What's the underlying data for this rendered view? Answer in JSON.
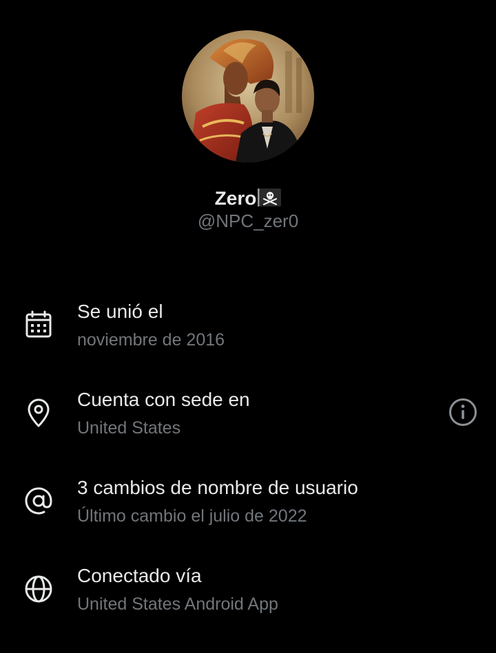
{
  "profile": {
    "display_name": "Zero",
    "name_emoji": "pirate-flag-emoji",
    "handle": "@NPC_zer0",
    "avatar": "profile-photo"
  },
  "info": [
    {
      "icon": "calendar-icon",
      "title": "Se unió el",
      "subtitle": "noviembre de 2016"
    },
    {
      "icon": "location-pin-icon",
      "title": "Cuenta con sede en",
      "subtitle": "United States",
      "action_icon": "info-circle-icon"
    },
    {
      "icon": "at-sign-icon",
      "title": "3 cambios de nombre de usuario",
      "subtitle": "Último cambio el julio de 2022"
    },
    {
      "icon": "globe-icon",
      "title": "Conectado vía",
      "subtitle": "United States Android App"
    }
  ],
  "colors": {
    "background": "#000000",
    "primary_text": "#e7e9ea",
    "secondary_text": "#71767b",
    "icon": "#e7e9ea"
  }
}
